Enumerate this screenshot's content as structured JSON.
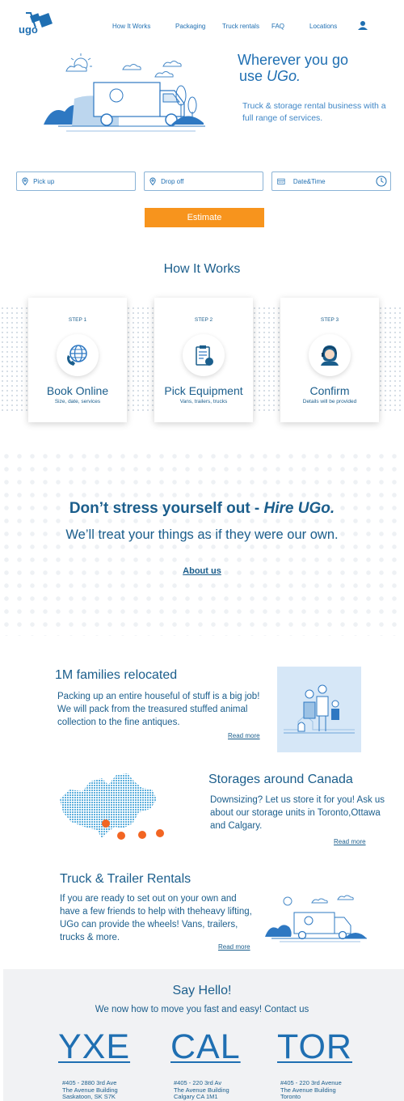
{
  "nav": {
    "brand": "ugo",
    "items": [
      "How It Works",
      "Packaging",
      "Truck rentals",
      "FAQ",
      "Locations"
    ],
    "account_icon": "user-icon"
  },
  "hero": {
    "title_line1": "Wherever you go",
    "title_line2_prefix": "use ",
    "title_line2_brand": "UGo.",
    "subtitle": "Truck & storage rental business with a full range of services."
  },
  "search": {
    "pickup_placeholder": "Pick up",
    "dropoff_placeholder": "Drop off",
    "datetime_placeholder": "Date&Time",
    "estimate_label": "Estimate"
  },
  "how_it_works": {
    "title": "How It Works",
    "steps": [
      {
        "step": "STEP 1",
        "title": "Book Online",
        "sub": "Size, date, services",
        "icon": "globe-phone-icon"
      },
      {
        "step": "STEP 2",
        "title": "Pick Equipment",
        "sub": "Vans, trailers, trucks",
        "icon": "clipboard-icon"
      },
      {
        "step": "STEP 3",
        "title": "Confirm",
        "sub": "Details will be provided",
        "icon": "support-agent-icon"
      }
    ]
  },
  "stress": {
    "line1_prefix": "Don’t stress yourself out - ",
    "line1_brand": "Hire UGo.",
    "line2": "We’ll treat your things as if they were our own.",
    "about_link": "About us"
  },
  "features": [
    {
      "title": "1M families relocated",
      "text": "Packing up an entire houseful of stuff is a big job! We will pack  from the treasured stuffed animal collection to the fine antiques.",
      "link": "Read more"
    },
    {
      "title": "Storages around Canada",
      "text": "Downsizing? Let us store it for you! Ask us about our storage units in Toronto,Ottawa and Calgary.",
      "link": "Read more"
    },
    {
      "title": "Truck & Trailer Rentals",
      "text": "If you are ready to set out on your own and have a few friends to help with theheavy lifting, UGo can provide the wheels! Vans, trailers, trucks & more.",
      "link": "Read more"
    }
  ],
  "contact": {
    "title": "Say Hello!",
    "subtitle": "We now how to move you fast and easy! Contact us",
    "offices": [
      {
        "code": "YXE",
        "line1": "#405 - 2880 3rd Ave",
        "line2": "The Avenue Building",
        "line3": "Saskatoon, SK S7K"
      },
      {
        "code": "CAL",
        "line1": "#405 - 220 3rd Av",
        "line2": "The Avenue Building",
        "line3": "Calgary CA  1M1"
      },
      {
        "code": "TOR",
        "line1": "#405 - 220 3rd Avenue",
        "line2": "The Avenue Building",
        "line3": "Toronto"
      }
    ]
  },
  "colors": {
    "primary": "#1f6fb2",
    "dark": "#1b5e8c",
    "accent": "#f7941d",
    "map_dot": "#f26522"
  }
}
